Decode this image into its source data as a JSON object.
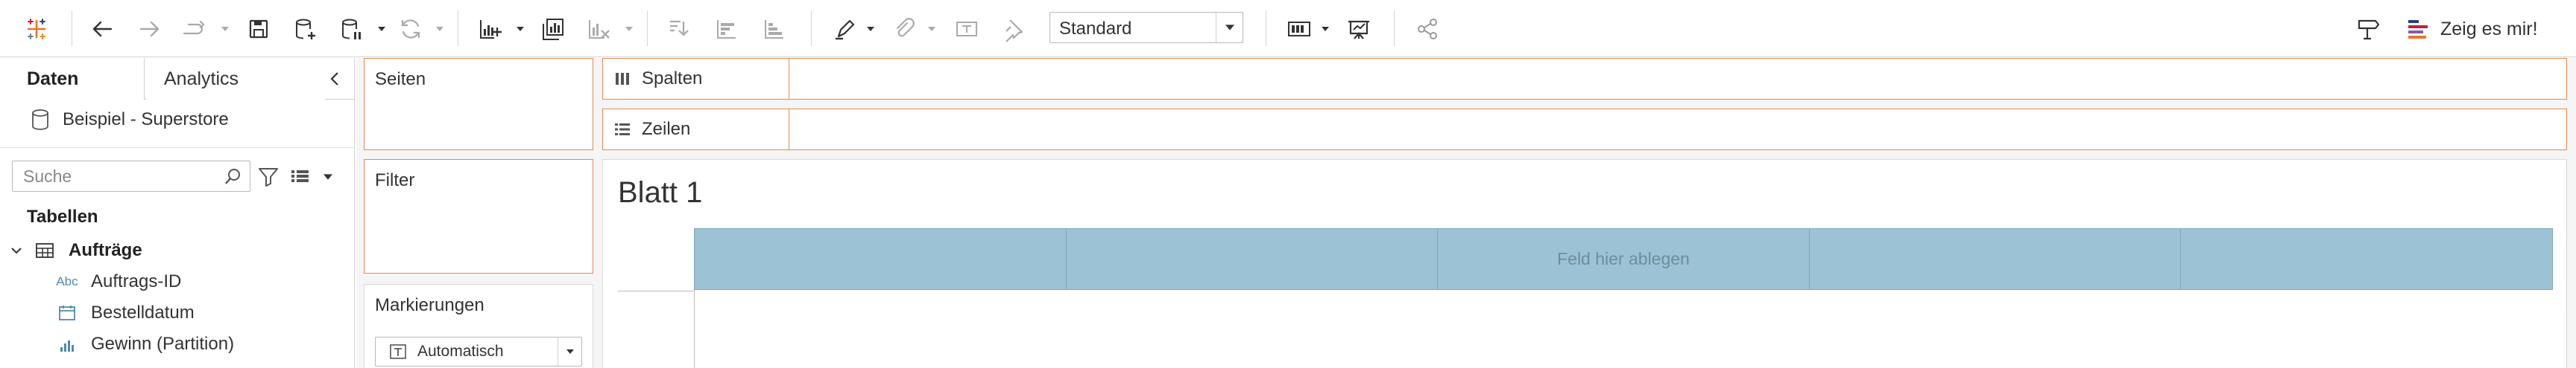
{
  "toolbar": {
    "icons": [
      "tableau-logo-icon",
      "undo-icon",
      "redo-icon",
      "replay-icon",
      "save-icon",
      "new-datasource-icon",
      "pause-updates-icon",
      "refresh-icon",
      "new-worksheet-icon",
      "duplicate-sheet-icon",
      "clear-sheet-icon",
      "swap-rows-columns-icon",
      "sort-ascending-icon",
      "sort-descending-icon",
      "highlight-icon",
      "group-members-icon",
      "show-mark-labels-icon",
      "pin-axes-icon",
      "show-cards-icon",
      "presentation-mode-icon",
      "share-icon",
      "tooltip-icon"
    ],
    "fit_value": "Standard",
    "show_me_label": "Zeig es mir!"
  },
  "data_pane": {
    "tab_data": "Daten",
    "tab_analytics": "Analytics",
    "datasource": "Beispiel - Superstore",
    "search_placeholder": "Suche",
    "tables_heading": "Tabellen",
    "table_name": "Aufträge",
    "fields": [
      {
        "name": "Auftrags-ID",
        "icon": "abc-icon"
      },
      {
        "name": "Bestelldatum",
        "icon": "calendar-icon"
      },
      {
        "name": "Gewinn (Partition)",
        "icon": "measure-icon"
      }
    ]
  },
  "cards": {
    "pages": "Seiten",
    "filters": "Filter",
    "marks": "Markierungen",
    "mark_type": "Automatisch"
  },
  "shelves": {
    "columns": "Spalten",
    "rows": "Zeilen"
  },
  "sheet": {
    "title": "Blatt 1",
    "drop_hint": "Feld hier ablegen"
  },
  "colors": {
    "accent_orange": "#e7894c",
    "drop_zone_blue": "#9cc3d5",
    "logo_blue": "#1f457e",
    "logo_orange": "#e8762d",
    "logo_red": "#c72035"
  }
}
